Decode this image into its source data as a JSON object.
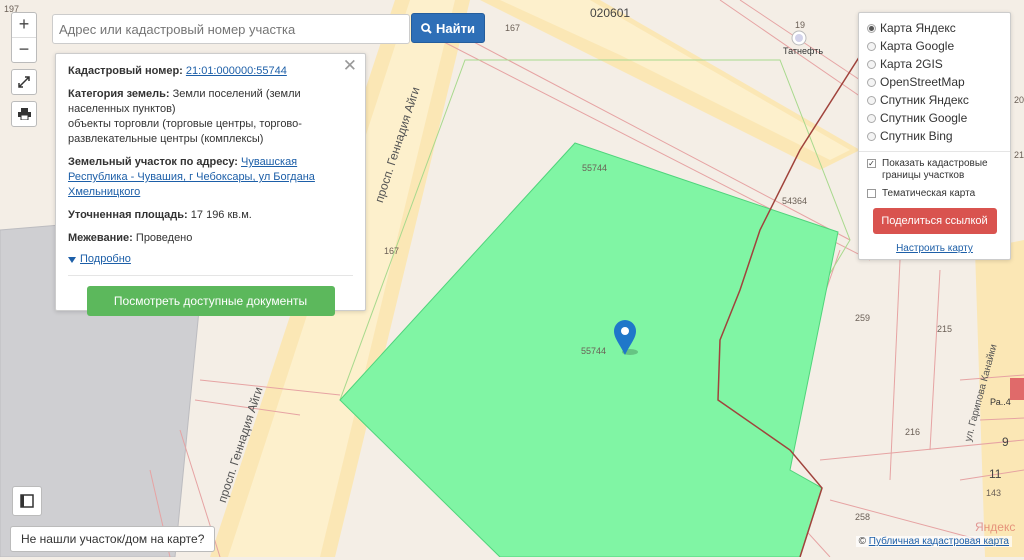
{
  "search": {
    "placeholder": "Адрес или кадастровый номер участка",
    "button_label": "Найти"
  },
  "zoom": {
    "plus": "+",
    "minus": "−"
  },
  "info_panel": {
    "cadastral_label": "Кадастровый номер:",
    "cadastral_value": "21:01:000000:55744",
    "category_label": "Категория земель:",
    "category_value": "Земли поселений (земли населенных пунктов)",
    "use_value": "объекты торговли (торговые центры, торгово-развлекательные центры (комплексы)",
    "address_label": "Земельный участок по адресу:",
    "address_value": "Чувашская Республика - Чувашия, г Чебоксары, ул Богдана Хмельницкого",
    "area_label": "Уточненная площадь:",
    "area_value": "17 196 кв.м.",
    "survey_label": "Межевание:",
    "survey_value": "Проведено",
    "more_link": "Подробно",
    "docs_button": "Посмотреть доступные документы"
  },
  "layers": {
    "options": [
      "Карта Яндекс",
      "Карта Google",
      "Карта 2GIS",
      "OpenStreetMap",
      "Спутник Яндекс",
      "Спутник Google",
      "Спутник Bing"
    ],
    "selected_index": 0,
    "show_boundaries": "Показать кадастровые границы участков",
    "show_boundaries_checked": true,
    "thematic_map": "Тематическая карта",
    "thematic_checked": false,
    "share_button": "Поделиться ссылкой",
    "setup_link": "Настроить карту"
  },
  "map_labels": {
    "quarter": "020601",
    "n197": "197",
    "n167_top": "167",
    "n167_mid": "167",
    "parcel_top": "55744",
    "parcel_center": "55744",
    "n54364": "54364",
    "n259": "259",
    "n215": "215",
    "n216": "216",
    "n258": "258",
    "n9": "9",
    "n11": "11",
    "n143": "143",
    "n19": "19",
    "tatneft": "Татнефть",
    "ra": "Ра..4",
    "n20": "20",
    "n21": "21",
    "street_1": "просп. Геннадия Айги",
    "street_2": "просп. Геннадия Айги",
    "street_3": "ул. Гарипова Канайки",
    "yandex": "Яндекс"
  },
  "not_found_button": "Не нашли участок/дом на карте?",
  "copyright": {
    "symbol": "©",
    "link": "Публичная кадастровая карта"
  },
  "colors": {
    "parcel_fill": "#80f5a4",
    "search_button": "#2e6fb7",
    "docs_button": "#5cb85c",
    "share_button": "#d9534f",
    "road": "#fbe3a8",
    "boundary": "#e8a0a0",
    "route": "#a0433c"
  }
}
